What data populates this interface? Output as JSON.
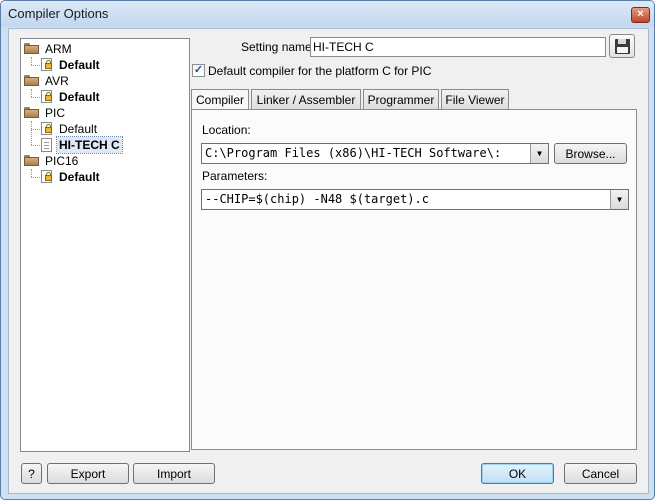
{
  "window": {
    "title": "Compiler Options",
    "close_glyph": "×"
  },
  "tree": {
    "groups": [
      {
        "label": "ARM",
        "children": [
          {
            "label": "Default",
            "bold": true,
            "icon": "locked-document-icon"
          }
        ]
      },
      {
        "label": "AVR",
        "children": [
          {
            "label": "Default",
            "bold": true,
            "icon": "locked-document-icon"
          }
        ]
      },
      {
        "label": "PIC",
        "children": [
          {
            "label": "Default",
            "bold": false,
            "icon": "locked-document-icon"
          },
          {
            "label": "HI-TECH C",
            "bold": true,
            "icon": "document-icon",
            "selected": true
          }
        ]
      },
      {
        "label": "PIC16",
        "children": [
          {
            "label": "Default",
            "bold": true,
            "icon": "locked-document-icon"
          }
        ]
      }
    ]
  },
  "setting": {
    "label": "Setting name:",
    "value": "HI-TECH C"
  },
  "default_checkbox": {
    "checked": true,
    "label": "Default compiler for the platform C for PIC",
    "mark": "✓"
  },
  "tabs": [
    {
      "label": "Compiler",
      "active": true
    },
    {
      "label": "Linker / Assembler",
      "active": false
    },
    {
      "label": "Programmer",
      "active": false
    },
    {
      "label": "File Viewer",
      "active": false
    }
  ],
  "compiler_tab": {
    "location_label": "Location:",
    "location_value": "C:\\Program Files (x86)\\HI-TECH Software\\:",
    "browse_label": "Browse...",
    "parameters_label": "Parameters:",
    "parameters_value": "--CHIP=$(chip) -N48 $(target).c",
    "dropdown_glyph": "▼"
  },
  "buttons": {
    "help": "?",
    "export": "Export",
    "import": "Import",
    "ok": "OK",
    "cancel": "Cancel"
  }
}
